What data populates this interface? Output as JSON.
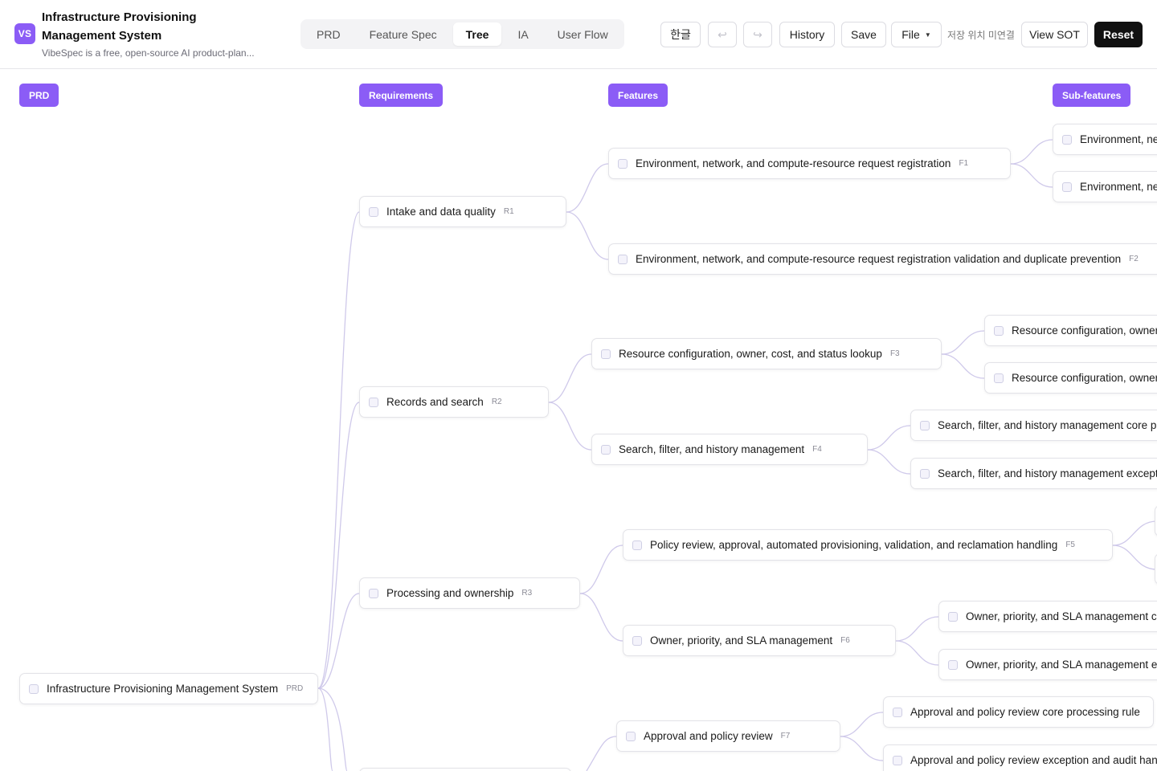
{
  "header": {
    "logo": "VS",
    "title": "Infrastructure Provisioning Management System",
    "subtitle": "VibeSpec is a free, open-source AI product-plan...",
    "tabs": [
      "PRD",
      "Feature Spec",
      "Tree",
      "IA",
      "User Flow"
    ],
    "active_tab": "Tree",
    "lang_button": "한글",
    "undo_icon": "undo-icon",
    "redo_icon": "redo-icon",
    "history": "History",
    "save": "Save",
    "file": "File",
    "storage_status": "저장 위치 미연결",
    "view_sot": "View SOT",
    "reset": "Reset"
  },
  "columns": {
    "prd": "PRD",
    "requirements": "Requirements",
    "features": "Features",
    "subfeatures": "Sub-features"
  },
  "colors": {
    "accent": "#8b5cf6",
    "link": "#cfc9ea",
    "dark": "#111111"
  },
  "tree": {
    "root": {
      "label": "Infrastructure Provisioning Management System",
      "code": "PRD"
    },
    "requirements": [
      {
        "label": "Intake and data quality",
        "code": "R1"
      },
      {
        "label": "Records and search",
        "code": "R2"
      },
      {
        "label": "Processing and ownership",
        "code": "R3"
      }
    ],
    "features": [
      {
        "label": "Environment, network, and compute-resource request registration",
        "code": "F1"
      },
      {
        "label": "Environment, network, and compute-resource request registration validation and duplicate prevention",
        "code": "F2"
      },
      {
        "label": "Resource configuration, owner, cost, and status lookup",
        "code": "F3"
      },
      {
        "label": "Search, filter, and history management",
        "code": "F4"
      },
      {
        "label": "Policy review, approval, automated provisioning, validation, and reclamation handling",
        "code": "F5"
      },
      {
        "label": "Owner, priority, and SLA management",
        "code": "F6"
      },
      {
        "label": "Approval and policy review",
        "code": "F7"
      }
    ],
    "subfeatures": [
      {
        "label": "Environment, net"
      },
      {
        "label": "Environment, net"
      },
      {
        "label": "Resource configuration, owner, c"
      },
      {
        "label": "Resource configuration, owner, c"
      },
      {
        "label": "Search, filter, and history management core proc"
      },
      {
        "label": "Search, filter, and history management exception"
      },
      {
        "label": "Owner, priority, and SLA management core"
      },
      {
        "label": "Owner, priority, and SLA management exc"
      },
      {
        "label": "Approval and policy review core processing rule"
      },
      {
        "label": "Approval and policy review exception and audit handli"
      }
    ]
  }
}
